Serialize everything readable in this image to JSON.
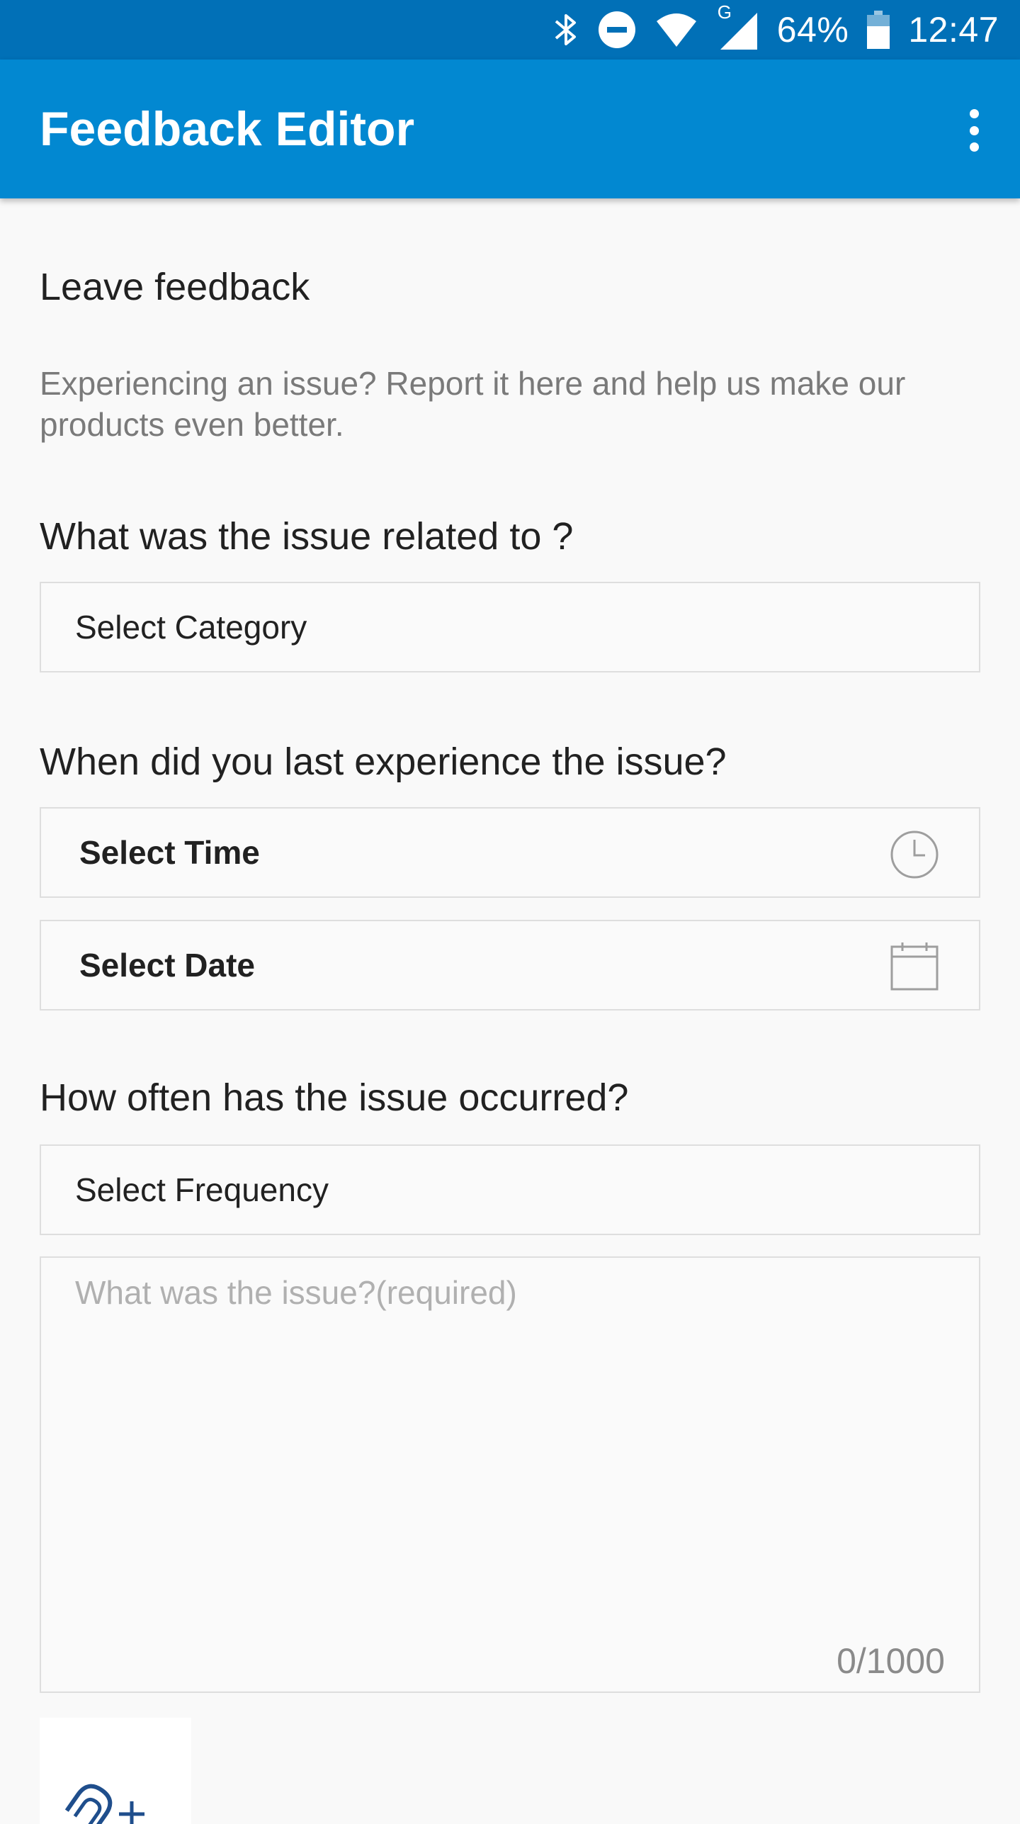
{
  "status_bar": {
    "network_label": "G",
    "battery_percent": "64%",
    "time": "12:47"
  },
  "app_bar": {
    "title": "Feedback Editor",
    "menu_icon": "more-vertical-icon"
  },
  "form": {
    "heading": "Leave feedback",
    "intro": "Experiencing an issue? Report it here and help us make our products even better.",
    "q_category": "What was the issue related to ?",
    "category_placeholder": "Select Category",
    "q_when": "When did you last experience the issue?",
    "time_placeholder": "Select Time",
    "date_placeholder": "Select Date",
    "q_frequency": "How often has the issue occurred?",
    "frequency_placeholder": "Select Frequency",
    "issue_placeholder": "What was the issue?(required)",
    "char_counter": "0/1000",
    "attach_icon": "paperclip-plus-icon"
  },
  "colors": {
    "status_bar": "#0170b7",
    "app_bar": "#0288d1",
    "background": "#f9f9f9",
    "attach_icon": "#1f4e8c"
  }
}
